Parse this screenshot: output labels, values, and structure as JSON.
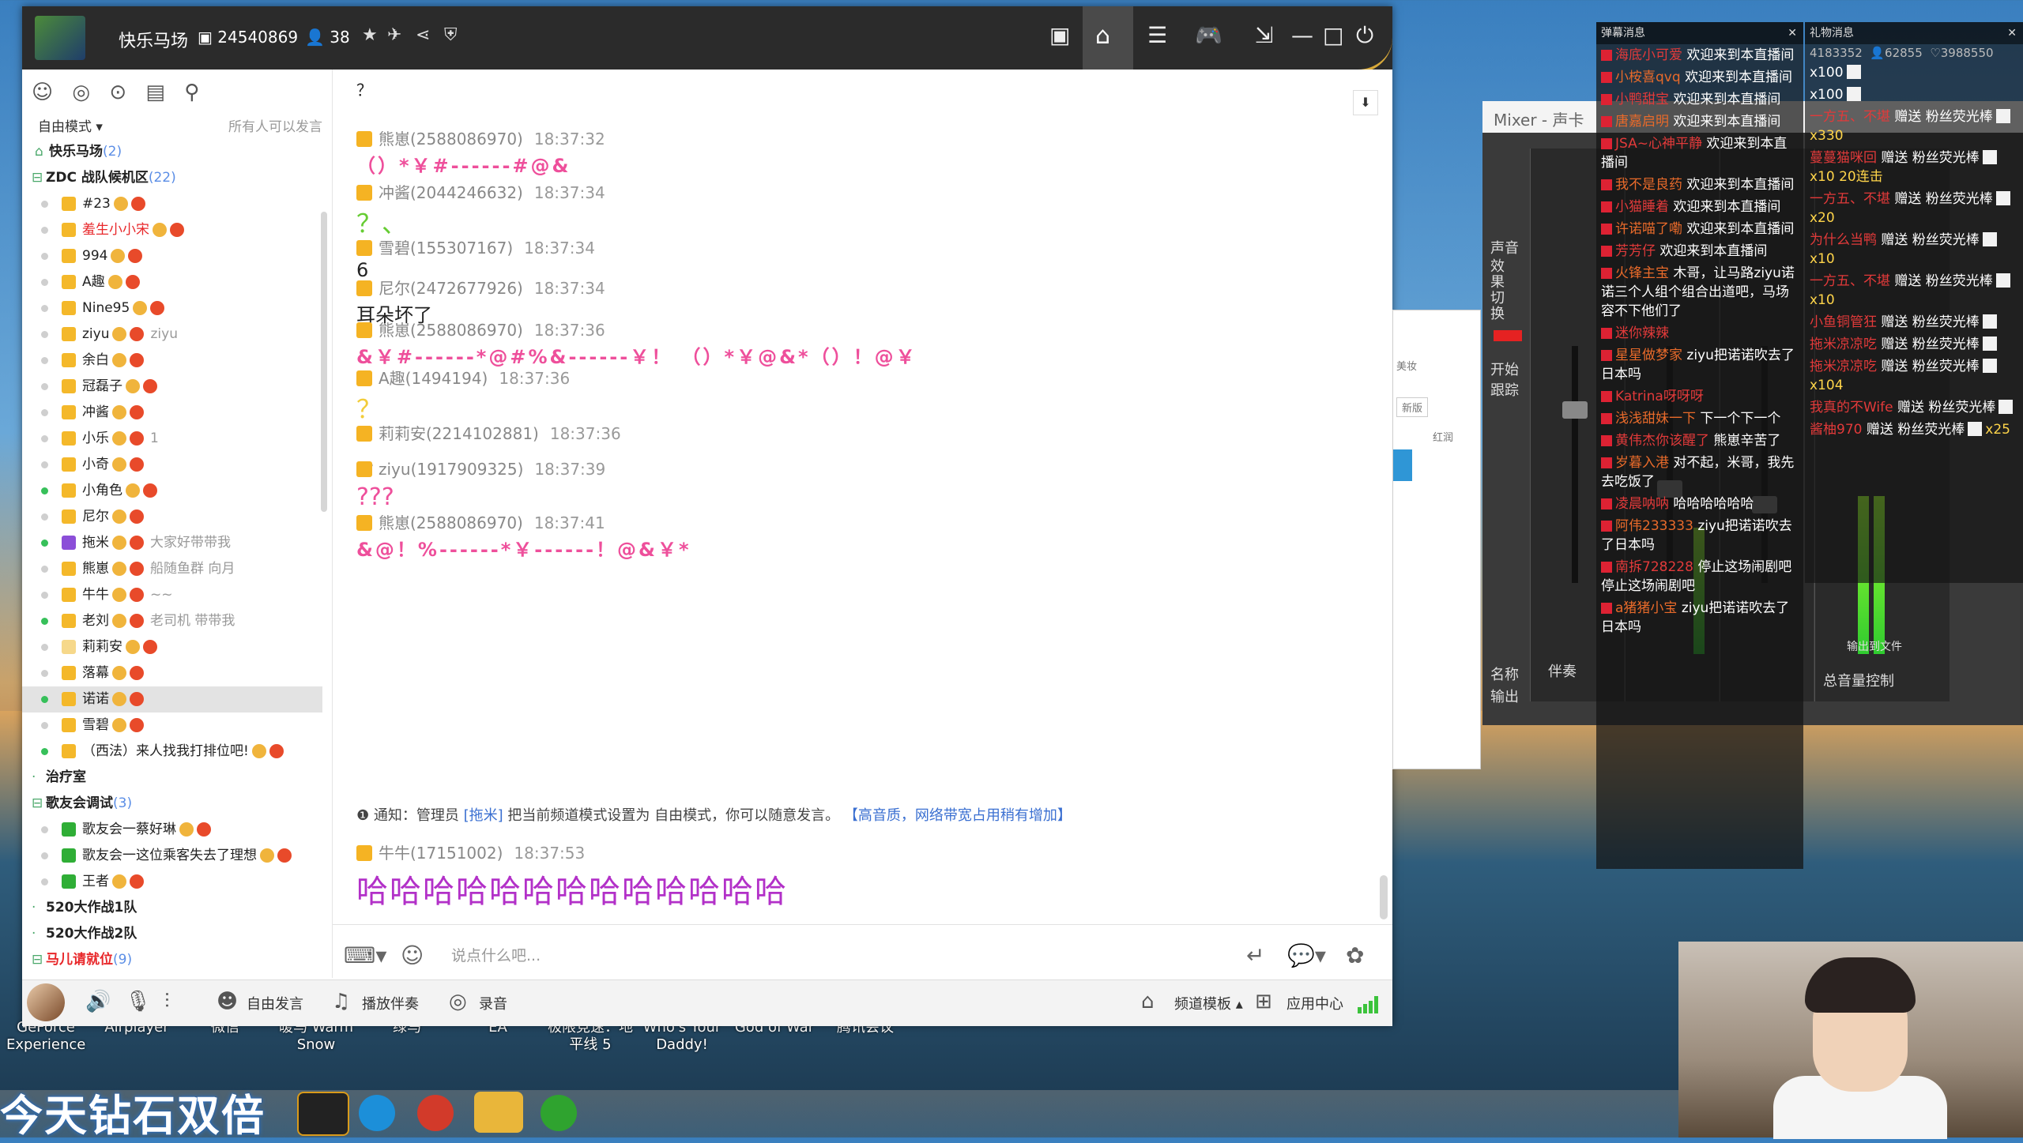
{
  "desktop": {
    "icons": [
      "GeForce\nExperience",
      "Airplayer",
      "微信",
      "暖马 Warm\nSnow",
      "绿马",
      "EA",
      "极限竞速：地\n平线 5",
      "Who's Your\nDaddy!",
      "God of War",
      "腾讯会议"
    ],
    "banner": "今天钻石双倍"
  },
  "window": {
    "channel_name": "快乐马场",
    "channel_id": "24540869",
    "online_count": "38",
    "left": {
      "mode": "自由模式",
      "mode_right": "所有人可以发言",
      "tree": [
        {
          "text": "快乐马场",
          "count": "(2)",
          "type": "root"
        },
        {
          "text": "ZDC 战队候机区",
          "count": "(22)",
          "type": "group"
        },
        {
          "text": "#23",
          "type": "user",
          "dot": "off",
          "vest": "gold"
        },
        {
          "text": "羞生小小宋",
          "type": "user",
          "dot": "off",
          "vest": "gold",
          "red": true
        },
        {
          "text": "994",
          "type": "user",
          "dot": "off",
          "vest": "gold"
        },
        {
          "text": "A趣",
          "type": "user",
          "dot": "off",
          "vest": "gold"
        },
        {
          "text": "Nine95",
          "type": "user",
          "dot": "off",
          "vest": "gold"
        },
        {
          "text": "ziyu",
          "type": "user",
          "dot": "off",
          "vest": "gold",
          "note": "ziyu"
        },
        {
          "text": "余白",
          "type": "user",
          "dot": "off",
          "vest": "gold"
        },
        {
          "text": "冠磊子",
          "type": "user",
          "dot": "off",
          "vest": "gold"
        },
        {
          "text": "冲酱",
          "type": "user",
          "dot": "off",
          "vest": "gold"
        },
        {
          "text": "小乐",
          "type": "user",
          "dot": "off",
          "vest": "gold",
          "note": "1"
        },
        {
          "text": "小奇",
          "type": "user",
          "dot": "off",
          "vest": "gold"
        },
        {
          "text": "小角色",
          "type": "user",
          "dot": "on",
          "vest": "gold"
        },
        {
          "text": "尼尔",
          "type": "user",
          "dot": "off",
          "vest": "gold"
        },
        {
          "text": "拖米",
          "type": "user",
          "dot": "on",
          "vest": "purple",
          "note": "大家好带带我"
        },
        {
          "text": "熊崽",
          "type": "user",
          "dot": "off",
          "vest": "gold",
          "note": "船随鱼群 向月"
        },
        {
          "text": "牛牛",
          "type": "user",
          "dot": "off",
          "vest": "gold",
          "note": "~~"
        },
        {
          "text": "老刘",
          "type": "user",
          "dot": "on",
          "vest": "gold",
          "note": "老司机 带带我"
        },
        {
          "text": "莉莉安",
          "type": "user",
          "dot": "off",
          "vest": "white"
        },
        {
          "text": "落幕",
          "type": "user",
          "dot": "off",
          "vest": "gold"
        },
        {
          "text": "诺诺",
          "type": "user",
          "dot": "on",
          "vest": "gold",
          "selected": true
        },
        {
          "text": "雪碧",
          "type": "user",
          "dot": "off",
          "vest": "gold"
        },
        {
          "text": "（西法）来人找我打排位吧!",
          "type": "user",
          "dot": "on",
          "vest": "gold"
        },
        {
          "text": "治疗室",
          "type": "group"
        },
        {
          "text": "歌友会调试",
          "count": "(3)",
          "type": "group"
        },
        {
          "text": "歌友会一蔡好琳",
          "type": "user",
          "dot": "off",
          "vest": "green"
        },
        {
          "text": "歌友会一这位乘客失去了理想",
          "type": "user",
          "dot": "off",
          "vest": "green"
        },
        {
          "text": "王者",
          "type": "user",
          "dot": "off",
          "vest": "green"
        },
        {
          "text": "520大作战1队",
          "type": "group"
        },
        {
          "text": "520大作战2队",
          "type": "group"
        },
        {
          "text": "马儿请就位",
          "count": "(9)",
          "type": "group",
          "red": true
        }
      ]
    },
    "chat": {
      "top_char": "？",
      "messages": [
        {
          "user": "熊崽(2588086970)",
          "time": "18:37:32",
          "text": "（）*￥#------#@&",
          "style": "pink"
        },
        {
          "user": "冲酱(2044246632)",
          "time": "18:37:34",
          "text": "？、",
          "style": "green"
        },
        {
          "user": "雪碧(155307167)",
          "time": "18:37:34",
          "text": "6",
          "style": "plain"
        },
        {
          "user": "尼尔(2472677926)",
          "time": "18:37:34",
          "text": "耳朵坏了",
          "style": "plain"
        },
        {
          "user": "熊崽(2588086970)",
          "time": "18:37:36",
          "text": "&￥#------*@#%&------￥！ （）*￥@&*（）！@￥",
          "style": "pink"
        },
        {
          "user": "A趣(1494194)",
          "time": "18:37:36",
          "text": "？",
          "style": "yellow"
        },
        {
          "user": "莉莉安(2214102881)",
          "time": "18:37:36",
          "text": "。。",
          "style": "plain"
        },
        {
          "user": "ziyu(1917909325)",
          "time": "18:37:39",
          "text": "???",
          "style": "pinkq"
        },
        {
          "user": "熊崽(2588086970)",
          "time": "18:37:41",
          "text": "&@！%------*￥------！@&￥*",
          "style": "pink"
        }
      ],
      "notice": {
        "prefix": "通知：管理员",
        "admin": "[拖米]",
        "text": "把当前频道模式设置为 自由模式，你可以随意发言。",
        "tip": "【高音质，网络带宽占用稍有增加】"
      },
      "last": {
        "user": "牛牛(17151002)",
        "time": "18:37:53",
        "text": "哈哈哈哈哈哈哈哈哈哈哈哈哈"
      },
      "placeholder": "说点什么吧..."
    },
    "bottom": {
      "free_speak": "自由发言",
      "play_music": "播放伴奏",
      "record": "录音",
      "template": "频道模板",
      "app_center": "应用中心"
    }
  },
  "mixer": {
    "title": "Mixer - 声卡",
    "labels": [
      "声音",
      "效果切换",
      "开始",
      "跟踪",
      "名称",
      "输出",
      "伴奏",
      "总音量控制",
      "输出到文件"
    ]
  },
  "beauty": {
    "label1": "美妆",
    "label2": "新版",
    "label3": "红润"
  },
  "danmaku": {
    "title": "弹幕消息",
    "lines": [
      {
        "name": "海底小可爱",
        "text": "欢迎来到本直播间"
      },
      {
        "name": "小桉喜qvq",
        "text": "欢迎来到本直播间"
      },
      {
        "name": "小鸭甜宝",
        "text": "欢迎来到本直播间"
      },
      {
        "name": "唐嘉启明",
        "text": "欢迎来到本直播间"
      },
      {
        "name": "JSA~心神平静",
        "text": "欢迎来到本直播间"
      },
      {
        "name": "我不是良药",
        "text": "欢迎来到本直播间"
      },
      {
        "name": "小猫睡着",
        "text": "欢迎来到本直播间"
      },
      {
        "name": "许诺喵了嘞",
        "text": "欢迎来到本直播间"
      },
      {
        "name": "芳芳仔",
        "text": "欢迎来到本直播间"
      },
      {
        "name": "火锋主宝",
        "text": "木哥，让马路ziyu诺诺三个人组个组合出道吧，马场容不下他们了"
      },
      {
        "name": "迷你辣辣",
        "text": ""
      },
      {
        "name": "星星做梦家",
        "text": "ziyu把诺诺吹去了日本吗"
      },
      {
        "name": "Katrina呀呀呀",
        "text": ""
      },
      {
        "name": "浅浅甜妹一下",
        "text": "下一个下一个"
      },
      {
        "name": "黄伟杰你该醒了",
        "text": "熊崽辛苦了"
      },
      {
        "name": "岁暮入港",
        "text": "对不起，米哥，我先去吃饭了"
      },
      {
        "name": "凌晨呐呐",
        "text": "哈哈哈哈哈哈"
      },
      {
        "name": "阿伟233333",
        "text": "ziyu把诺诺吹去了日本吗"
      },
      {
        "name": "南拆728228",
        "text": "停止这场闹剧吧停止这场闹剧吧"
      },
      {
        "name": "a猪猪小宝",
        "text": "ziyu把诺诺吹去了日本吗"
      }
    ]
  },
  "gift": {
    "title": "礼物消息",
    "stats": [
      "4183352",
      "62855",
      "3988550"
    ],
    "lines": [
      {
        "text": "x100"
      },
      {
        "text": "x100"
      },
      {
        "name": "一方五、不堪",
        "text": "赠送 粉丝荧光棒",
        "qty": "x330"
      },
      {
        "name": "蔓蔓猫咪回",
        "text": "赠送 粉丝荧光棒",
        "qty": "x10 20连击"
      },
      {
        "name": "一方五、不堪",
        "text": "赠送 粉丝荧光棒",
        "qty": "x20"
      },
      {
        "name": "为什么当鸭",
        "text": "赠送 粉丝荧光棒",
        "qty": "x10"
      },
      {
        "name": "一方五、不堪",
        "text": "赠送 粉丝荧光棒",
        "qty": "x10"
      },
      {
        "name": "小鱼铜管狂",
        "text": "赠送 粉丝荧光棒",
        "qty": ""
      },
      {
        "name": "拖米凉凉吃",
        "text": "赠送 粉丝荧光棒",
        "qty": ""
      },
      {
        "name": "拖米凉凉吃",
        "text": "赠送 粉丝荧光棒",
        "qty": "x104"
      },
      {
        "name": "我真的不Wife",
        "text": "赠送 粉丝荧光棒",
        "qty": ""
      },
      {
        "name": "酱柚970",
        "text": "赠送 粉丝荧光棒",
        "qty": "x25"
      }
    ]
  }
}
